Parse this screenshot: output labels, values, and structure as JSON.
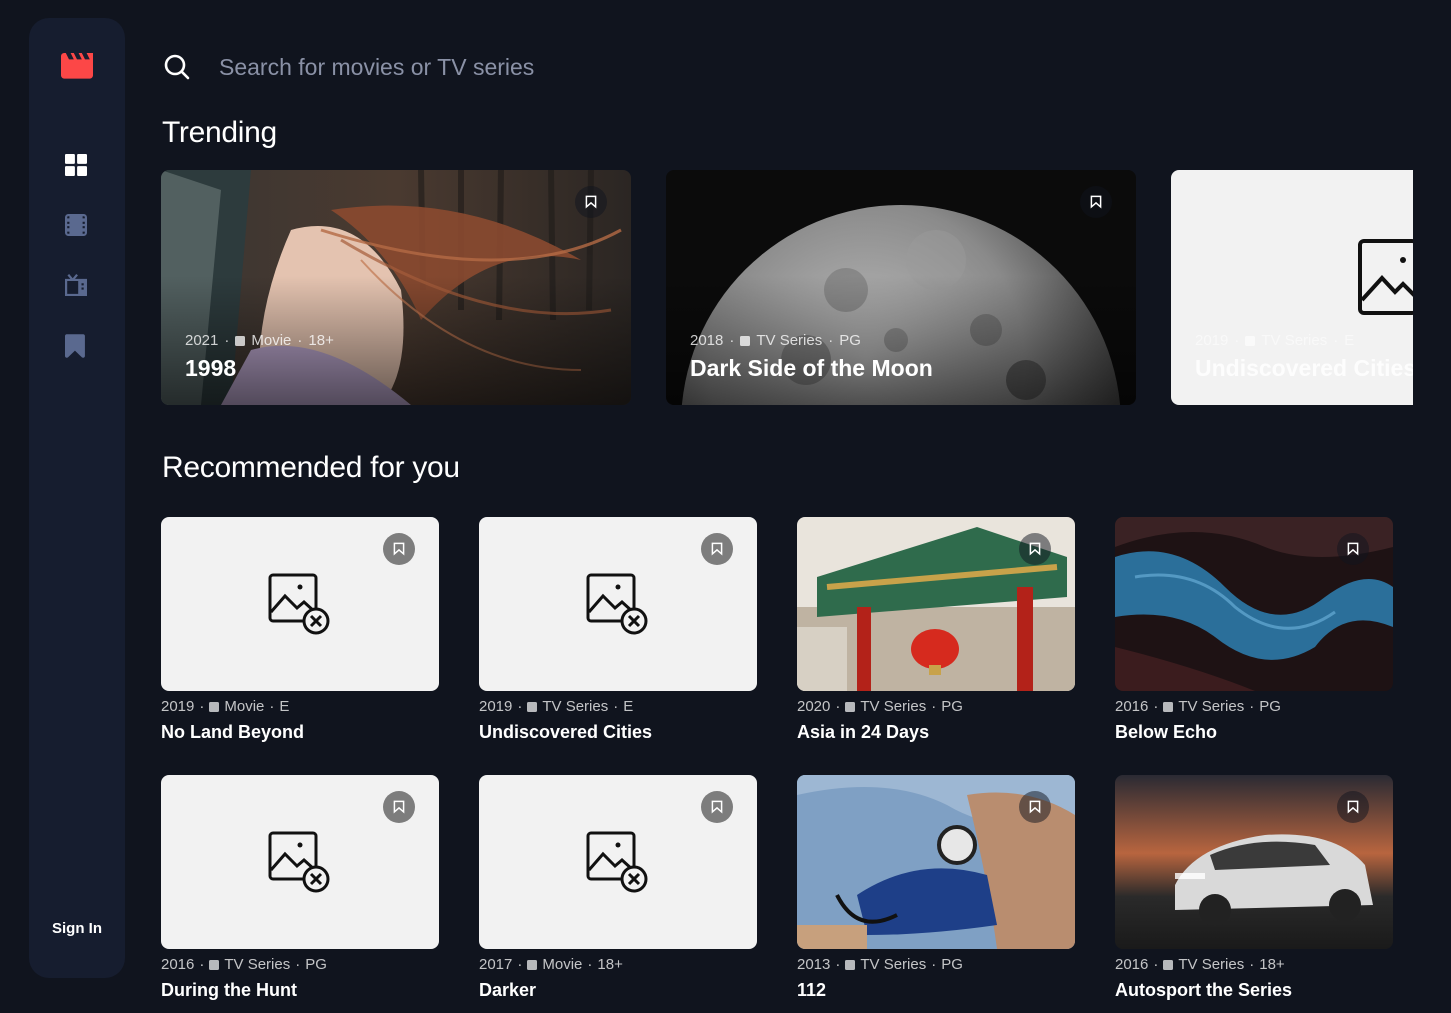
{
  "sidebar": {
    "logo_icon": "film-clapper-icon",
    "accent_color": "#fc4747",
    "nav": [
      {
        "name": "home",
        "icon": "grid-icon",
        "active": true
      },
      {
        "name": "movies",
        "icon": "film-strip-icon",
        "active": false
      },
      {
        "name": "tv-series",
        "icon": "tv-icon",
        "active": false
      },
      {
        "name": "bookmarks",
        "icon": "bookmark-icon",
        "active": false
      }
    ],
    "sign_in_label": "Sign In"
  },
  "search": {
    "placeholder": "Search for movies or TV series",
    "value": ""
  },
  "trending": {
    "heading": "Trending",
    "items": [
      {
        "year": "2021",
        "category": "Movie",
        "rating": "18+",
        "title": "1998",
        "image": "photo-woman-hair-wind"
      },
      {
        "year": "2018",
        "category": "TV Series",
        "rating": "PG",
        "title": "Dark Side of the Moon",
        "image": "photo-half-moon"
      },
      {
        "year": "2019",
        "category": "TV Series",
        "rating": "E",
        "title": "Undiscovered Cities",
        "image": "broken-image-placeholder"
      }
    ]
  },
  "recommended": {
    "heading": "Recommended for you",
    "items": [
      {
        "year": "2019",
        "category": "Movie",
        "rating": "E",
        "title": "No Land Beyond",
        "image": "broken-image-placeholder"
      },
      {
        "year": "2019",
        "category": "TV Series",
        "rating": "E",
        "title": "Undiscovered Cities",
        "image": "broken-image-placeholder"
      },
      {
        "year": "2020",
        "category": "TV Series",
        "rating": "PG",
        "title": "Asia in 24 Days",
        "image": "photo-chinese-temple-lantern"
      },
      {
        "year": "2016",
        "category": "TV Series",
        "rating": "PG",
        "title": "Below Echo",
        "image": "photo-canyon-night-sky"
      },
      {
        "year": "2016",
        "category": "TV Series",
        "rating": "PG",
        "title": "During the Hunt",
        "image": "broken-image-placeholder"
      },
      {
        "year": "2017",
        "category": "Movie",
        "rating": "18+",
        "title": "Darker",
        "image": "broken-image-placeholder"
      },
      {
        "year": "2013",
        "category": "TV Series",
        "rating": "PG",
        "title": "112",
        "image": "photo-blood-pressure-cuff"
      },
      {
        "year": "2016",
        "category": "TV Series",
        "rating": "18+",
        "title": "Autosport the Series",
        "image": "photo-white-car-sunset"
      }
    ]
  }
}
